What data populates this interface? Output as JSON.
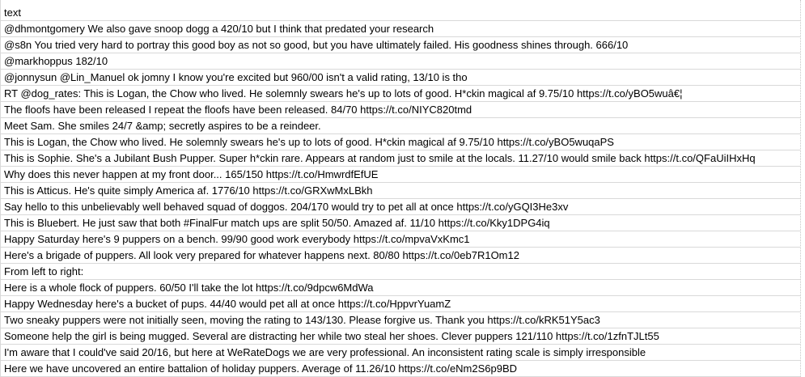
{
  "sheet": {
    "rows": [
      "text",
      "@dhmontgomery We also gave snoop dogg a 420/10 but I think that predated your research",
      "@s8n You tried very hard to portray this good boy as not so good, but you have ultimately failed. His goodness shines through. 666/10",
      "@markhoppus 182/10",
      "@jonnysun @Lin_Manuel ok jomny I know you're excited but 960/00 isn't a valid rating, 13/10 is tho",
      "RT @dog_rates: This is Logan, the Chow who lived. He solemnly swears he's up to lots of good. H*ckin magical af 9.75/10 https://t.co/yBO5wuâ€¦",
      "The floofs have been released I repeat the floofs have been released. 84/70 https://t.co/NIYC820tmd",
      "Meet Sam. She smiles 24/7 &amp; secretly aspires to be a reindeer.",
      "This is Logan, the Chow who lived. He solemnly swears he's up to lots of good. H*ckin magical af 9.75/10 https://t.co/yBO5wuqaPS",
      "This is Sophie. She's a Jubilant Bush Pupper. Super h*ckin rare. Appears at random just to smile at the locals. 11.27/10 would smile back https://t.co/QFaUiIHxHq",
      "Why does this never happen at my front door... 165/150 https://t.co/HmwrdfEfUE",
      "This is Atticus. He's quite simply America af. 1776/10 https://t.co/GRXwMxLBkh",
      "Say hello to this unbelievably well behaved squad of doggos. 204/170 would try to pet all at once https://t.co/yGQI3He3xv",
      "This is Bluebert. He just saw that both #FinalFur match ups are split 50/50. Amazed af. 11/10 https://t.co/Kky1DPG4iq",
      "Happy Saturday here's 9 puppers on a bench. 99/90 good work everybody https://t.co/mpvaVxKmc1",
      "Here's a brigade of puppers. All look very prepared for whatever happens next. 80/80 https://t.co/0eb7R1Om12",
      "From left to right:",
      "Here is a whole flock of puppers.  60/50 I'll take the lot https://t.co/9dpcw6MdWa",
      "Happy Wednesday here's a bucket of pups. 44/40 would pet all at once https://t.co/HppvrYuamZ",
      "Two sneaky puppers were not initially seen, moving the rating to 143/130. Please forgive us. Thank you https://t.co/kRK51Y5ac3",
      "Someone help the girl is being mugged. Several are distracting her while two steal her shoes. Clever puppers 121/110 https://t.co/1zfnTJLt55",
      "I'm aware that I could've said 20/16, but here at WeRateDogs we are very professional. An inconsistent rating scale is simply irresponsible",
      "Here we have uncovered an entire battalion of holiday puppers. Average of 11.26/10 https://t.co/eNm2S6p9BD"
    ]
  }
}
